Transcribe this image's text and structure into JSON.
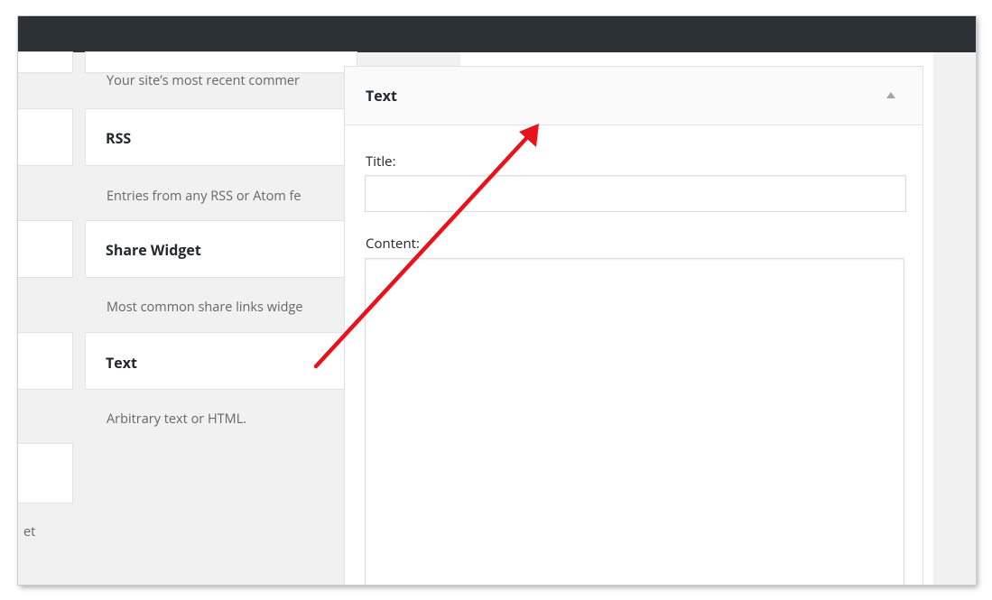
{
  "available_widgets": [
    {
      "title": "",
      "description": "Your site’s most recent commer"
    },
    {
      "title": "RSS",
      "description": "Entries from any RSS or Atom fe"
    },
    {
      "title": "Share Widget",
      "description": "Most common share links widge"
    },
    {
      "title": "Text",
      "description": "Arbitrary text or HTML."
    }
  ],
  "left_column": {
    "fragment_text": "et"
  },
  "widget_panel": {
    "title": "Text",
    "title_label": "Title:",
    "title_value": "",
    "content_label": "Content:",
    "content_value": ""
  },
  "annotation": {
    "color": "#e8121c"
  }
}
